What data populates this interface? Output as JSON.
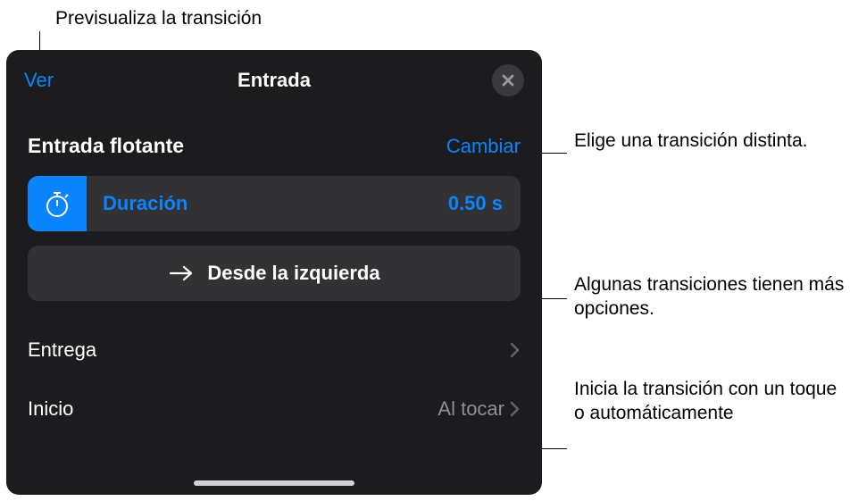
{
  "callouts": {
    "preview": "Previsualiza la transición",
    "choose": "Elige una transición distinta.",
    "options": "Algunas transiciones tienen más opciones.",
    "start": "Inicia la transición con un toque o automáticamente"
  },
  "panel": {
    "header": {
      "ver": "Ver",
      "title": "Entrada"
    },
    "section": {
      "title": "Entrada flotante",
      "change": "Cambiar"
    },
    "duration": {
      "label": "Duración",
      "value": "0.50 s"
    },
    "direction": {
      "label": "Desde la izquierda"
    },
    "delivery": {
      "label": "Entrega"
    },
    "start": {
      "label": "Inicio",
      "value": "Al tocar"
    }
  }
}
